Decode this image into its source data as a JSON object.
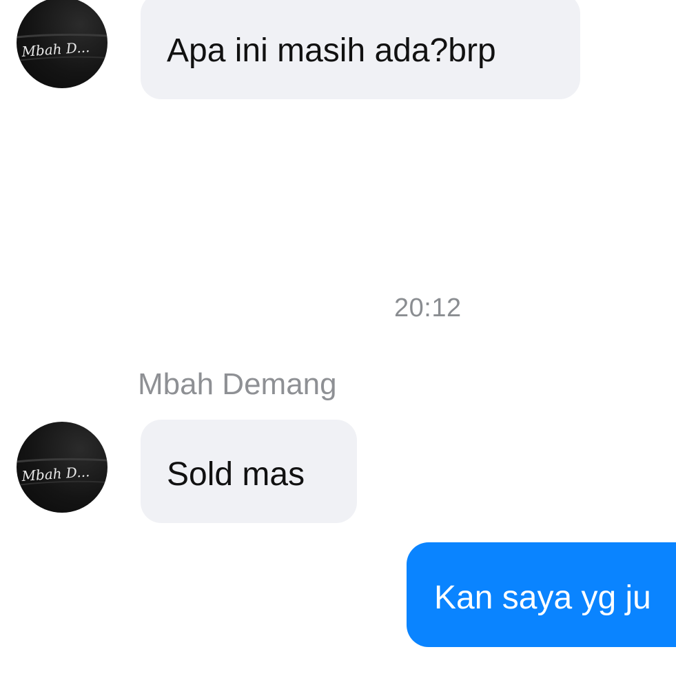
{
  "conversation": {
    "messages": [
      {
        "sender": "incoming",
        "text": "Apa ini masih ada?brp"
      },
      {
        "sender": "incoming",
        "text": "Sold mas"
      },
      {
        "sender": "outgoing",
        "text": "Kan saya yg ju"
      }
    ],
    "timestamp": "20:12",
    "sender_name": "Mbah Demang",
    "avatar_text": "Mbah D..."
  },
  "colors": {
    "incoming_bubble": "#f0f1f5",
    "outgoing_bubble": "#0a84ff",
    "muted_text": "#8a8d91"
  }
}
